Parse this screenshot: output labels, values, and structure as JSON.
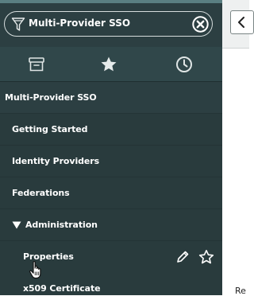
{
  "filter": {
    "value": "Multi-Provider SSO"
  },
  "tabs": [
    {
      "name": "archive-icon"
    },
    {
      "name": "star-icon"
    },
    {
      "name": "clock-icon"
    }
  ],
  "app": {
    "label": "Multi-Provider SSO"
  },
  "modules": [
    {
      "label": "Getting Started"
    },
    {
      "label": "Identity Providers"
    },
    {
      "label": "Federations"
    }
  ],
  "section": {
    "label": "Administration",
    "expanded": true
  },
  "submodules": [
    {
      "label": "Properties"
    },
    {
      "label": "x509 Certificate"
    }
  ],
  "right_panel": {
    "fragment": "Re"
  },
  "colors": {
    "nav_bg": "#2c3f42",
    "tab_bg": "#30474a",
    "text": "#ffffff"
  }
}
